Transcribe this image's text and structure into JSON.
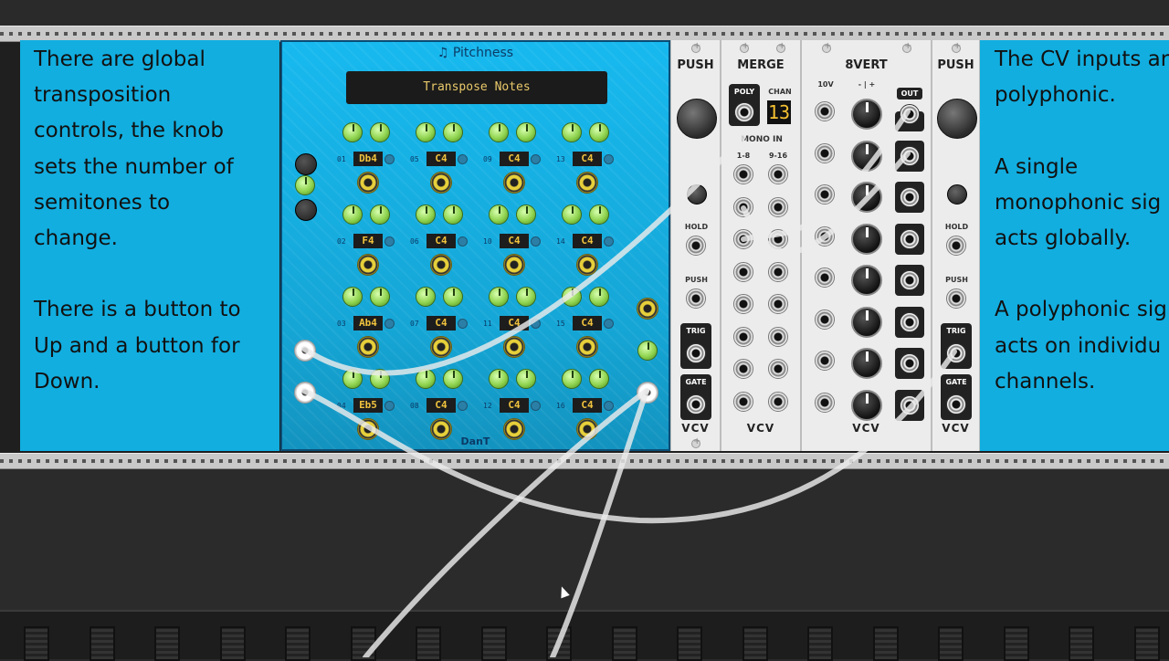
{
  "left_panel": {
    "text": "There are global\ntransposition\ncontrols, the knob\nsets the number of\nsemitones to\nchange.\n\nThere is a button to\nUp and a button for\nDown."
  },
  "right_panel": {
    "text": "The CV inputs ar\npolyphonic.\n\nA single\nmonophonic sig\nacts globally.\n\nA polyphonic sig\nacts on individu\nchannels."
  },
  "pitchness": {
    "title": "♫ Pitchness",
    "display": "Transpose Notes",
    "brand": "DanT",
    "notes": [
      {
        "num": "01",
        "label": "Db4"
      },
      {
        "num": "02",
        "label": "F4"
      },
      {
        "num": "03",
        "label": "Ab4"
      },
      {
        "num": "04",
        "label": "Eb5"
      },
      {
        "num": "05",
        "label": "C4"
      },
      {
        "num": "06",
        "label": "C4"
      },
      {
        "num": "07",
        "label": "C4"
      },
      {
        "num": "08",
        "label": "C4"
      },
      {
        "num": "09",
        "label": "C4"
      },
      {
        "num": "10",
        "label": "C4"
      },
      {
        "num": "11",
        "label": "C4"
      },
      {
        "num": "12",
        "label": "C4"
      },
      {
        "num": "13",
        "label": "C4"
      },
      {
        "num": "14",
        "label": "C4"
      },
      {
        "num": "15",
        "label": "C4"
      },
      {
        "num": "16",
        "label": "C4"
      }
    ]
  },
  "push1": {
    "title": "PUSH",
    "hold": "HOLD",
    "push": "PUSH",
    "trig": "TRIG",
    "gate": "GATE",
    "brand": "VCV"
  },
  "merge": {
    "title": "MERGE",
    "poly": "POLY",
    "chan": "CHAN",
    "chan_value": "13",
    "mono_in": "MONO IN",
    "col1": "1-8",
    "col2": "9-16",
    "brand": "VCV"
  },
  "eightvert": {
    "title": "8VERT",
    "tenv": "10V",
    "range": "- | +",
    "out": "OUT",
    "brand": "VCV"
  },
  "push2": {
    "title": "PUSH",
    "hold": "HOLD",
    "push": "PUSH",
    "trig": "TRIG",
    "gate": "GATE",
    "brand": "VCV"
  }
}
